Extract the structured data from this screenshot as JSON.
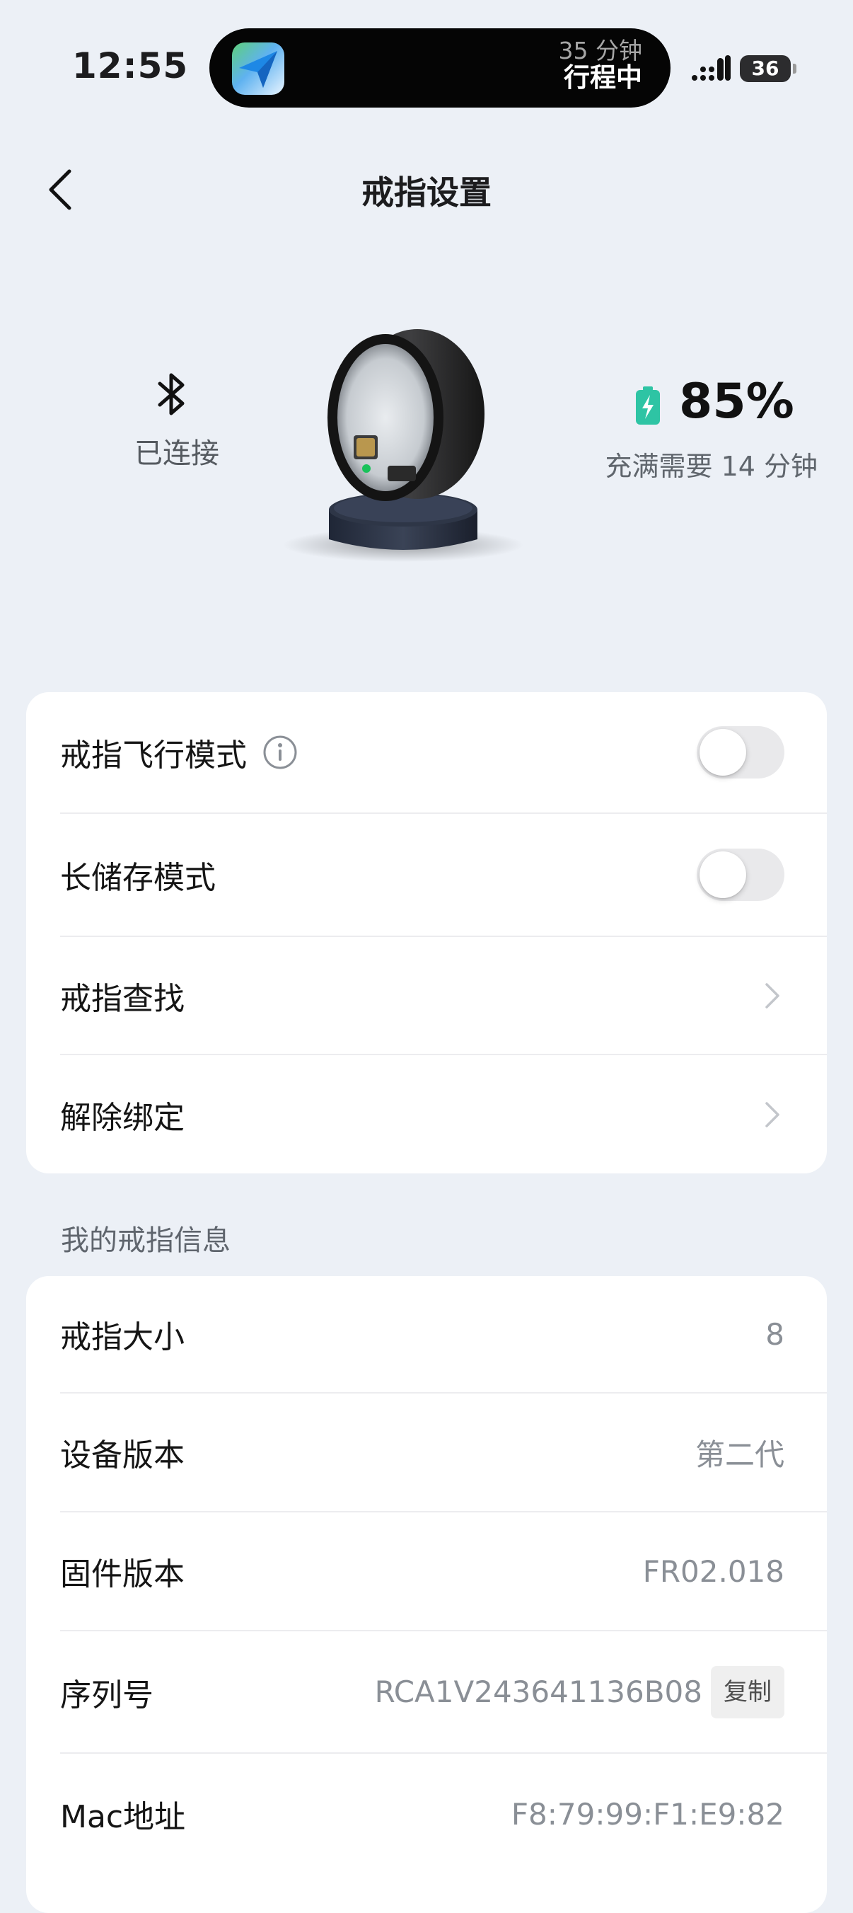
{
  "status_bar": {
    "time": "12:55",
    "island": {
      "app_icon": "navigation-arrow-icon",
      "subtitle": "35 分钟",
      "title": "行程中"
    },
    "battery_level": "36"
  },
  "header": {
    "title": "戒指设置",
    "back_icon": "chevron-left-icon"
  },
  "device": {
    "connection_icon": "bluetooth-icon",
    "connection_status": "已连接",
    "battery_percent": "85%",
    "charge_time": "充满需要 14 分钟",
    "charge_color": "#2ec4a4"
  },
  "settings": {
    "airplane_mode": {
      "label": "戒指飞行模式",
      "enabled": false
    },
    "long_storage_mode": {
      "label": "长储存模式",
      "enabled": false
    },
    "find_ring": {
      "label": "戒指查找"
    },
    "unbind": {
      "label": "解除绑定"
    }
  },
  "info_section": {
    "title": "我的戒指信息",
    "ring_size": {
      "label": "戒指大小",
      "value": "8"
    },
    "device_version": {
      "label": "设备版本",
      "value": "第二代"
    },
    "firmware_version": {
      "label": "固件版本",
      "value": "FR02.018"
    },
    "serial_number": {
      "label": "序列号",
      "value": "RCA1V243641136B08",
      "copy_label": "复制"
    },
    "mac_address": {
      "label": "Mac地址",
      "value": "F8:79:99:F1:E9:82"
    }
  }
}
